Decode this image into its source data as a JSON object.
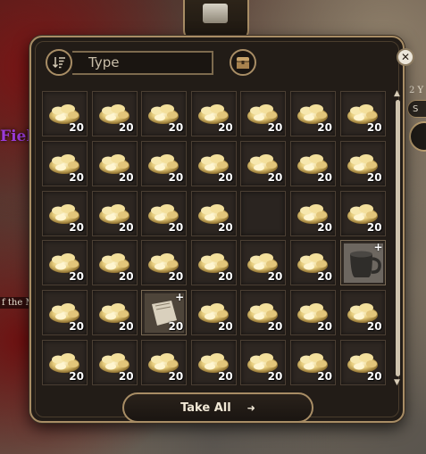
{
  "background": {
    "left_text": "Fiel",
    "left_small_text": "f the M",
    "right_text": "2 Y",
    "right_button_text": "S"
  },
  "toolbar": {
    "search_placeholder": "Type",
    "sort_icon": "sort-icon",
    "container_icon": "chest-icon",
    "close_icon": "close-icon"
  },
  "grid": {
    "columns": 7,
    "slots": [
      {
        "item": "gold",
        "count": "20"
      },
      {
        "item": "gold",
        "count": "20"
      },
      {
        "item": "gold",
        "count": "20"
      },
      {
        "item": "gold",
        "count": "20"
      },
      {
        "item": "gold",
        "count": "20"
      },
      {
        "item": "gold",
        "count": "20"
      },
      {
        "item": "gold",
        "count": "20"
      },
      {
        "item": "gold",
        "count": "20"
      },
      {
        "item": "gold",
        "count": "20"
      },
      {
        "item": "gold",
        "count": "20"
      },
      {
        "item": "gold",
        "count": "20"
      },
      {
        "item": "gold",
        "count": "20"
      },
      {
        "item": "gold",
        "count": "20"
      },
      {
        "item": "gold",
        "count": "20"
      },
      {
        "item": "gold",
        "count": "20"
      },
      {
        "item": "gold",
        "count": "20"
      },
      {
        "item": "gold",
        "count": "20"
      },
      {
        "item": "gold",
        "count": "20"
      },
      {
        "item": "empty",
        "count": ""
      },
      {
        "item": "gold",
        "count": "20"
      },
      {
        "item": "gold",
        "count": "20"
      },
      {
        "item": "gold",
        "count": "20"
      },
      {
        "item": "gold",
        "count": "20"
      },
      {
        "item": "gold",
        "count": "20"
      },
      {
        "item": "gold",
        "count": "20"
      },
      {
        "item": "gold",
        "count": "20"
      },
      {
        "item": "gold",
        "count": "20"
      },
      {
        "item": "tankard",
        "count": ""
      },
      {
        "item": "gold",
        "count": "20"
      },
      {
        "item": "gold",
        "count": "20"
      },
      {
        "item": "scroll",
        "count": "20"
      },
      {
        "item": "gold",
        "count": "20"
      },
      {
        "item": "gold",
        "count": "20"
      },
      {
        "item": "gold",
        "count": "20"
      },
      {
        "item": "gold",
        "count": "20"
      },
      {
        "item": "gold",
        "count": "20"
      },
      {
        "item": "gold",
        "count": "20"
      },
      {
        "item": "gold",
        "count": "20"
      },
      {
        "item": "gold",
        "count": "20"
      },
      {
        "item": "gold",
        "count": "20"
      },
      {
        "item": "gold",
        "count": "20"
      },
      {
        "item": "gold",
        "count": "20"
      }
    ]
  },
  "footer": {
    "take_all_label": "Take All"
  },
  "colors": {
    "frame_gold": "#a88d65",
    "panel_bg": "#221c17",
    "slot_bg": "#2e2722"
  }
}
